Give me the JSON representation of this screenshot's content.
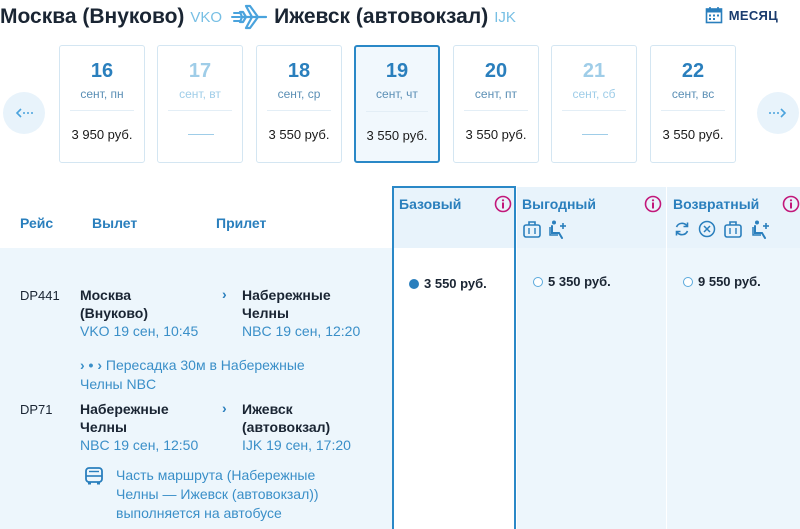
{
  "header": {
    "from_city": "Москва (Внуково)",
    "from_code": "VKO",
    "to_city": "Ижевск (автовокзал)",
    "to_code": "IJK",
    "month_label": "МЕСЯЦ"
  },
  "dates": [
    {
      "day": "16",
      "weekday": "сент, пн",
      "price": "3 950 руб.",
      "state": "normal"
    },
    {
      "day": "17",
      "weekday": "сент, вт",
      "price": "",
      "state": "disabled"
    },
    {
      "day": "18",
      "weekday": "сент, ср",
      "price": "3 550 руб.",
      "state": "normal"
    },
    {
      "day": "19",
      "weekday": "сент, чт",
      "price": "3 550 руб.",
      "state": "selected"
    },
    {
      "day": "20",
      "weekday": "сент, пт",
      "price": "3 550 руб.",
      "state": "normal"
    },
    {
      "day": "21",
      "weekday": "сент, сб",
      "price": "",
      "state": "disabled"
    },
    {
      "day": "22",
      "weekday": "сент, вс",
      "price": "3 550 руб.",
      "state": "normal"
    }
  ],
  "table": {
    "col_flight": "Рейс",
    "col_departure": "Вылет",
    "col_arrival": "Прилет"
  },
  "fares": [
    {
      "name": "Базовый",
      "price": "3 550 руб.",
      "selected": true
    },
    {
      "name": "Выгодный",
      "price": "5 350 руб.",
      "selected": false
    },
    {
      "name": "Возвратный",
      "price": "9 550 руб.",
      "selected": false
    }
  ],
  "segments": [
    {
      "flight": "DP441",
      "dep_city_1": "Москва",
      "dep_city_2": "(Внуково)",
      "dep_time": "VKO 19 сен, 10:45",
      "arr_city_1": "Набережные",
      "arr_city_2": "Челны",
      "arr_time": "NBC 19 сен, 12:20"
    },
    {
      "flight": "DP71",
      "dep_city_1": "Набережные",
      "dep_city_2": "Челны",
      "dep_time": "NBC 19 сен, 12:50",
      "arr_city_1": "Ижевск",
      "arr_city_2": "(автовокзал)",
      "arr_time": "IJK 19 сен, 17:20"
    }
  ],
  "transfer": {
    "line1": "Пересадка 30м в Набережные",
    "line2": "Челны NBC"
  },
  "bus_note": {
    "line1": "Часть маршрута (Набережные",
    "line2": "Челны — Ижевск (автовокзал))",
    "line3": "выполняется на автобусе"
  },
  "colors": {
    "accent": "#2a7fbd",
    "light_blue": "#77bfe4",
    "info_pink": "#c2177a",
    "panel_bg": "#edf6fc"
  }
}
